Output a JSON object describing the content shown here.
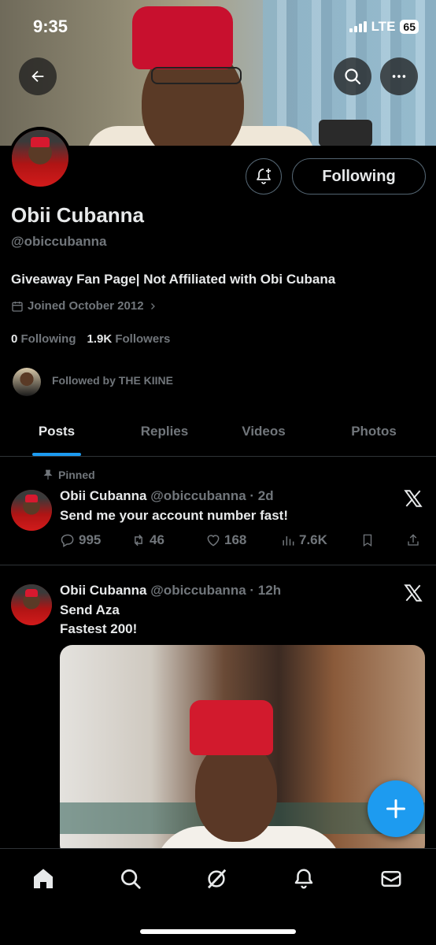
{
  "status_bar": {
    "time": "9:35",
    "network": "LTE",
    "battery": "65"
  },
  "profile": {
    "display_name": "Obii Cubanna",
    "handle": "@obiccubanna",
    "bio": "Giveaway Fan Page| Not Affiliated with Obi Cubana",
    "joined": "Joined October 2012",
    "following_count": "0",
    "following_label": "Following",
    "followers_count": "1.9K",
    "followers_label": "Followers",
    "followed_by": "Followed by THE KIINE",
    "follow_button_label": "Following"
  },
  "tabs": [
    {
      "label": "Posts",
      "active": true
    },
    {
      "label": "Replies",
      "active": false
    },
    {
      "label": "Videos",
      "active": false
    },
    {
      "label": "Photos",
      "active": false
    }
  ],
  "posts": [
    {
      "pinned_label": "Pinned",
      "name": "Obii Cubanna",
      "handle": "@obiccubanna",
      "time": "· 2d",
      "text": "Send me your account number fast!",
      "replies": "995",
      "reposts": "46",
      "likes": "168",
      "views": "7.6K"
    },
    {
      "name": "Obii Cubanna",
      "handle": "@obiccubanna",
      "time": "· 12h",
      "text_line1": "Send Aza",
      "text_line2": "Fastest 200!"
    }
  ],
  "colors": {
    "accent": "#1d9bf0",
    "background": "#000000",
    "muted": "#71767b",
    "hat_red": "#c8102e"
  },
  "icons": [
    "back-arrow-icon",
    "search-icon",
    "more-icon",
    "bell-plus-icon",
    "calendar-icon",
    "pin-icon",
    "x-logo-icon",
    "reply-icon",
    "repost-icon",
    "like-icon",
    "views-icon",
    "bookmark-icon",
    "share-icon",
    "plus-icon",
    "home-icon",
    "grok-icon",
    "notifications-icon",
    "messages-icon"
  ]
}
